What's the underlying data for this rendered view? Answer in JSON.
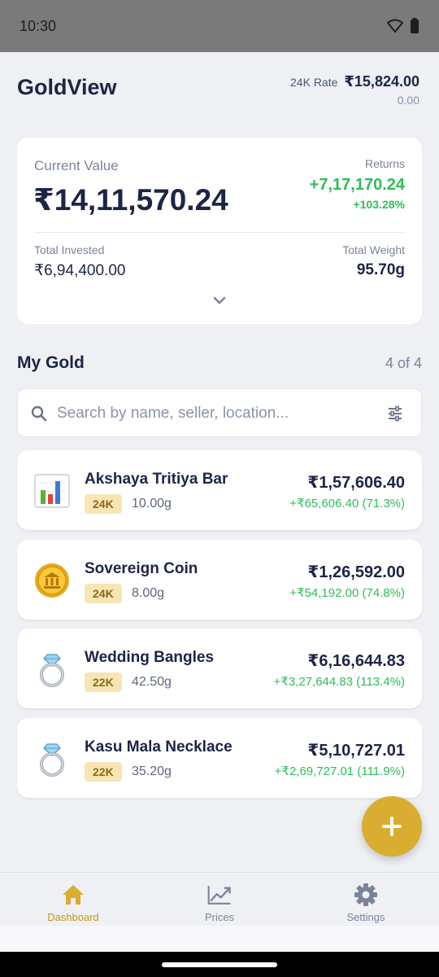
{
  "status_bar": {
    "time": "10:30",
    "icons": [
      "wifi-icon",
      "battery-icon"
    ]
  },
  "header": {
    "title": "GoldView",
    "rate_label": "24K Rate",
    "rate_value": "₹15,824.00",
    "rate_change": "0.00"
  },
  "summary": {
    "current_value_label": "Current Value",
    "current_value": "₹14,11,570.24",
    "returns_label": "Returns",
    "returns_value": "+7,17,170.24",
    "returns_percent": "+103.28%",
    "total_invested_label": "Total Invested",
    "total_invested": "₹6,94,400.00",
    "total_weight_label": "Total Weight",
    "total_weight": "95.70g"
  },
  "my_gold": {
    "title": "My Gold",
    "count": "4 of 4",
    "search_placeholder": "Search by name, seller, location..."
  },
  "items": [
    {
      "name": "Akshaya Tritiya Bar",
      "purity": "24K",
      "weight": "10.00g",
      "value": "₹1,57,606.40",
      "gain": "+₹65,606.40 (71.3%)",
      "icon": "bar-chart-icon"
    },
    {
      "name": "Sovereign Coin",
      "purity": "24K",
      "weight": "8.00g",
      "value": "₹1,26,592.00",
      "gain": "+₹54,192.00 (74.8%)",
      "icon": "coin-icon"
    },
    {
      "name": "Wedding Bangles",
      "purity": "22K",
      "weight": "42.50g",
      "value": "₹6,16,644.83",
      "gain": "+₹3,27,644.83 (113.4%)",
      "icon": "ring-icon"
    },
    {
      "name": "Kasu Mala Necklace",
      "purity": "22K",
      "weight": "35.20g",
      "value": "₹5,10,727.01",
      "gain": "+₹2,69,727.01 (111.9%)",
      "icon": "ring-icon"
    }
  ],
  "bottom_nav": [
    {
      "label": "Dashboard",
      "icon": "home-icon",
      "active": true
    },
    {
      "label": "Prices",
      "icon": "trend-chart-icon",
      "active": false
    },
    {
      "label": "Settings",
      "icon": "gear-icon",
      "active": false
    }
  ],
  "colors": {
    "accent": "#d9ad2f",
    "positive": "#2ebd59",
    "text": "#1c2545"
  }
}
